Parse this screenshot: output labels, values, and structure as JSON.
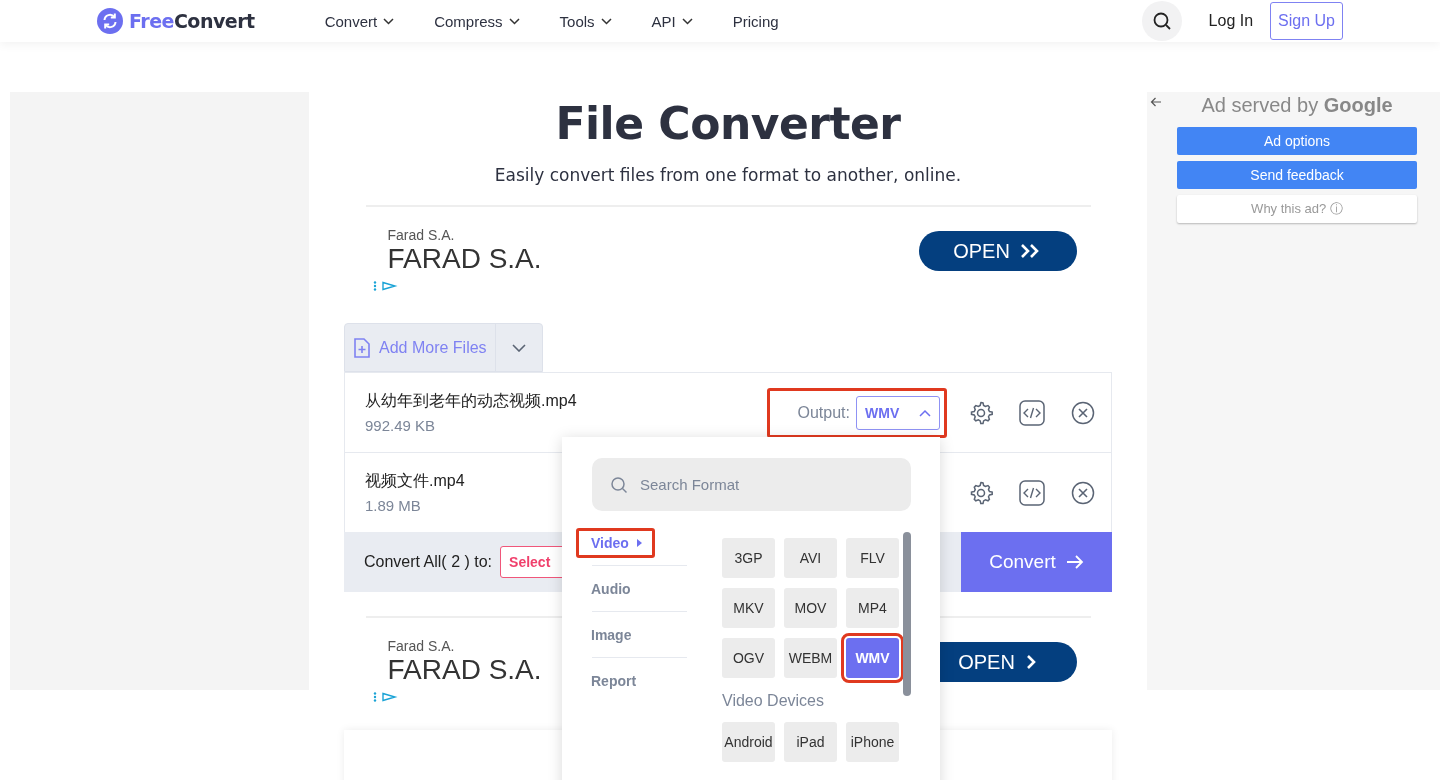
{
  "header": {
    "logo": {
      "accent": "Free",
      "rest": "Convert"
    },
    "nav": [
      {
        "label": "Convert",
        "dropdown": true
      },
      {
        "label": "Compress",
        "dropdown": true
      },
      {
        "label": "Tools",
        "dropdown": true
      },
      {
        "label": "API",
        "dropdown": true
      },
      {
        "label": "Pricing",
        "dropdown": false
      }
    ],
    "login": "Log In",
    "signup": "Sign Up"
  },
  "hero": {
    "title": "File Converter",
    "subtitle": "Easily convert files from one format to another, online."
  },
  "ads": [
    {
      "advertiser": "Farad S.A.",
      "headline": "FARAD S.A.",
      "button": "OPEN",
      "kind": "double"
    },
    {
      "advertiser": "Farad S.A.",
      "headline": "FARAD S.A.",
      "button": "OPEN",
      "kind": "single"
    }
  ],
  "add_files": {
    "label": "Add More Files"
  },
  "files": [
    {
      "name": "从幼年到老年的动态视频.mp4",
      "size": "992.49 KB",
      "output": {
        "label": "Output:",
        "value": "WMV",
        "expanded": true,
        "highlighted": true
      }
    },
    {
      "name": "视频文件.mp4",
      "size": "1.89 MB"
    }
  ],
  "convert_bar": {
    "label": "Convert All( 2 ) to:",
    "select": "Select",
    "button": "Convert"
  },
  "format_menu": {
    "search_placeholder": "Search Format",
    "categories": [
      {
        "label": "Video",
        "selected": true,
        "highlighted": true
      },
      {
        "label": "Audio",
        "selected": false,
        "highlighted": false
      },
      {
        "label": "Image",
        "selected": false,
        "highlighted": false
      },
      {
        "label": "Report",
        "selected": false,
        "highlighted": false
      }
    ],
    "formats": [
      {
        "label": "3GP",
        "selected": false,
        "highlighted": false
      },
      {
        "label": "AVI",
        "selected": false,
        "highlighted": false
      },
      {
        "label": "FLV",
        "selected": false,
        "highlighted": false
      },
      {
        "label": "MKV",
        "selected": false,
        "highlighted": false
      },
      {
        "label": "MOV",
        "selected": false,
        "highlighted": false
      },
      {
        "label": "MP4",
        "selected": false,
        "highlighted": false
      },
      {
        "label": "OGV",
        "selected": false,
        "highlighted": false
      },
      {
        "label": "WEBM",
        "selected": false,
        "highlighted": false
      },
      {
        "label": "WMV",
        "selected": true,
        "highlighted": true
      }
    ],
    "devices_title": "Video Devices",
    "devices": [
      {
        "label": "Android",
        "selected": false
      },
      {
        "label": "iPad",
        "selected": false
      },
      {
        "label": "iPhone",
        "selected": false
      }
    ]
  },
  "side_ad": {
    "title": "Ad served by **Google**",
    "buttons": [
      {
        "label": "Ad options",
        "kind": "primary"
      },
      {
        "label": "Send feedback",
        "kind": "primary"
      },
      {
        "label": "Why this ad? ⓘ",
        "kind": "plain"
      }
    ]
  }
}
